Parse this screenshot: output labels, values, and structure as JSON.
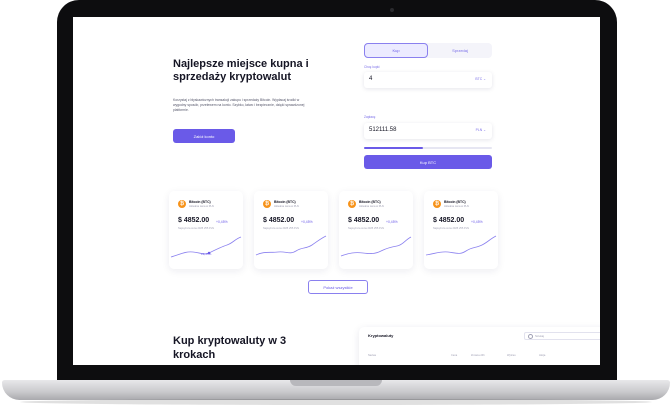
{
  "hero": {
    "title": "Najlepsze miejsce kupna i sprzedaży kryptowalut",
    "description": "Korzystaj z błyskawicznych transakcji zakupu i sprzedaży Bitcoin. Wypłacaj środki w wygodny sposób, przelewem na konto. Szybko, łatwo i bezpiecznie, dzięki sprawdzonej platformie.",
    "cta_label": "Załóż konto"
  },
  "trade": {
    "tab_buy": "Kup",
    "tab_sell": "Sprzedaj",
    "amount_label": "Chcę kupić",
    "amount_value": "4",
    "amount_unit": "BTC ⌄",
    "pay_label": "Zapłacę",
    "pay_value": "512111.58",
    "pay_unit": "PLN ⌄",
    "progress": 0.46,
    "buy_label": "Kup BTC"
  },
  "cards": [
    {
      "name": "Bitcoin (BTC)",
      "sub": "Aktualna cena w PLN",
      "price": "$ 4852.00",
      "change": "+0,45%",
      "note": "Najwyższa cena 2025 255 PLN",
      "tag": "+0,45%"
    },
    {
      "name": "Bitcoin (BTC)",
      "sub": "Aktualna cena w PLN",
      "price": "$ 4852.00",
      "change": "+0,45%",
      "note": "Najwyższa cena 2025 255 PLN",
      "tag": ""
    },
    {
      "name": "Bitcoin (BTC)",
      "sub": "Aktualna cena w PLN",
      "price": "$ 4852.00",
      "change": "+0,45%",
      "note": "Najwyższa cena 2025 255 PLN",
      "tag": ""
    },
    {
      "name": "Bitcoin (BTC)",
      "sub": "Aktualna cena w PLN",
      "price": "$ 4852.00",
      "change": "+0,45%",
      "note": "Najwyższa cena 2025 255 PLN",
      "tag": ""
    }
  ],
  "show_all_label": "Pokaż wszystkie",
  "section2": {
    "title": "Kup kryptowaluty w 3 krokach",
    "panel_title": "Kryptowaluty",
    "search_placeholder": "Szukaj",
    "columns": [
      "Nazwa",
      "Cena",
      "Zmiana 24h",
      "Wykres",
      "Akcja"
    ]
  },
  "colors": {
    "accent": "#6a5ae8",
    "coin": "#f7931a",
    "text": "#151524"
  },
  "icons": {
    "coin": "bitcoin-icon",
    "search": "search-icon"
  }
}
